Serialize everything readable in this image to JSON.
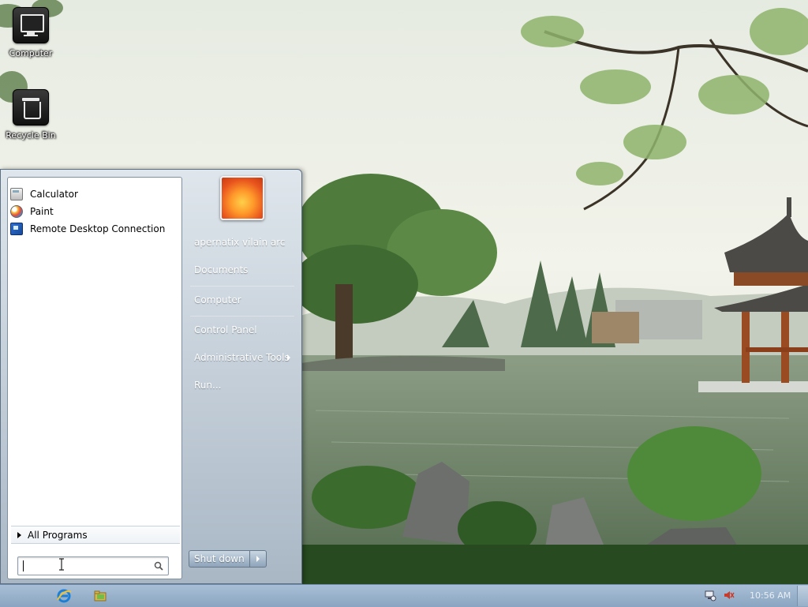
{
  "desktop": {
    "icons": [
      {
        "label": "Computer",
        "icon": "computer-icon"
      },
      {
        "label": "Recycle Bin",
        "icon": "recycle-bin-icon"
      }
    ]
  },
  "start_menu": {
    "programs": [
      {
        "label": "Calculator",
        "icon": "calculator-icon"
      },
      {
        "label": "Paint",
        "icon": "paint-icon"
      },
      {
        "label": "Remote Desktop Connection",
        "icon": "remote-desktop-icon"
      }
    ],
    "all_programs_label": "All Programs",
    "search": {
      "value": "",
      "placeholder": ""
    },
    "user_name": "apernatix vilain arc",
    "right_items": [
      {
        "label": "Documents"
      },
      {
        "label": "Computer"
      },
      {
        "label": "Control Panel"
      },
      {
        "label": "Administrative Tools",
        "has_submenu": true
      },
      {
        "label": "Run..."
      }
    ],
    "shutdown_label": "Shut down"
  },
  "taskbar": {
    "pinned": [
      {
        "name": "Internet Explorer",
        "icon": "internet-explorer-icon"
      },
      {
        "name": "Windows Explorer",
        "icon": "folder-icon"
      }
    ],
    "clock": "10:56 AM",
    "tray_icons": [
      "network-icon",
      "volume-muted-icon"
    ]
  },
  "colors": {
    "start_menu_right_top": "#dfe6ec",
    "start_menu_right_bottom": "#a9b7c5",
    "taskbar": "#9bb4cc",
    "accent": "#2e6fd0"
  }
}
